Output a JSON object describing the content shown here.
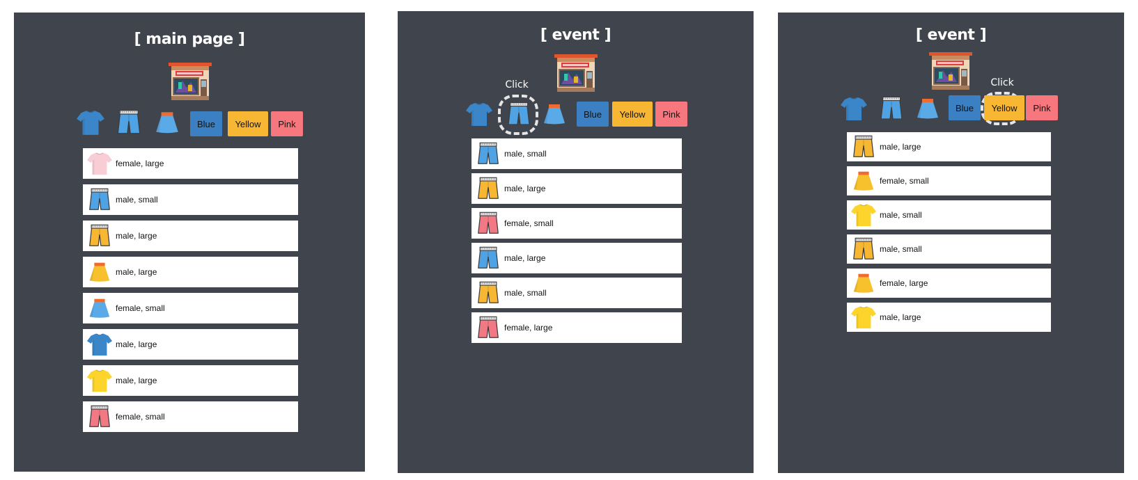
{
  "panels": [
    {
      "title": "[ main page ]",
      "click_label": "",
      "buttons": {
        "blue": "Blue",
        "yellow": "Yellow",
        "pink": "Pink"
      },
      "items": [
        {
          "icon": "tshirt-icon",
          "color": "#f9cdd6",
          "text": "female, large"
        },
        {
          "icon": "shorts-icon",
          "color": "#4fa2e4",
          "text": "male, small"
        },
        {
          "icon": "shorts-icon",
          "color": "#f7b733",
          "text": "male, large"
        },
        {
          "icon": "skirt-icon",
          "color": "#f7c12d",
          "text": "male, large"
        },
        {
          "icon": "skirt-icon",
          "color": "#5aaae8",
          "text": "female, small"
        },
        {
          "icon": "tshirt-icon",
          "color": "#3a86c8",
          "text": "male, large"
        },
        {
          "icon": "tshirt-icon",
          "color": "#fcd42b",
          "text": "male, large"
        },
        {
          "icon": "shorts-icon",
          "color": "#f27883",
          "text": "female, small"
        }
      ]
    },
    {
      "title": "[ event ]",
      "click_label": "Click",
      "buttons": {
        "blue": "Blue",
        "yellow": "Yellow",
        "pink": "Pink"
      },
      "items": [
        {
          "icon": "shorts-icon",
          "color": "#4fa2e4",
          "text": "male, small"
        },
        {
          "icon": "shorts-icon",
          "color": "#f7b733",
          "text": "male, large"
        },
        {
          "icon": "shorts-icon",
          "color": "#f27883",
          "text": "female, small"
        },
        {
          "icon": "shorts-icon",
          "color": "#4fa2e4",
          "text": "male, large"
        },
        {
          "icon": "shorts-icon",
          "color": "#f7b733",
          "text": "male, small"
        },
        {
          "icon": "shorts-icon",
          "color": "#f27883",
          "text": "female, large"
        }
      ]
    },
    {
      "title": "[ event ]",
      "click_label": "Click",
      "buttons": {
        "blue": "Blue",
        "yellow": "Yellow",
        "pink": "Pink"
      },
      "items": [
        {
          "icon": "shorts-icon",
          "color": "#f7b733",
          "text": "male, large"
        },
        {
          "icon": "skirt-icon",
          "color": "#f7c12d",
          "text": "female, small"
        },
        {
          "icon": "tshirt-icon",
          "color": "#fcd42b",
          "text": "male, small"
        },
        {
          "icon": "shorts-icon",
          "color": "#f7b733",
          "text": "male, small"
        },
        {
          "icon": "skirt-icon",
          "color": "#f7c12d",
          "text": "female, large"
        },
        {
          "icon": "tshirt-icon",
          "color": "#fcd42b",
          "text": "male, large"
        }
      ]
    }
  ],
  "filter_icons": {
    "tshirt": {
      "icon": "tshirt-icon",
      "color": "#3a86c8"
    },
    "shorts": {
      "icon": "shorts-icon",
      "color": "#4fa2e4"
    },
    "skirt": {
      "icon": "skirt-icon",
      "color": "#5aaae8"
    }
  }
}
